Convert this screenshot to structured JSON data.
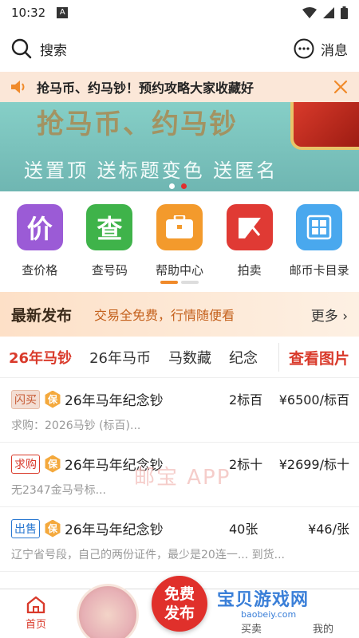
{
  "status_bar": {
    "time": "10:32",
    "sys_icon": "A"
  },
  "top_bar": {
    "search_label": "搜索",
    "messages_label": "消息"
  },
  "notice": {
    "text": "抢马币、约马钞！预约攻略大家收藏好"
  },
  "banner": {
    "line1": "抢马币、约马钞",
    "line2": "送置顶 送标题变色 送匿名"
  },
  "quick_links": [
    {
      "label": "查价格",
      "glyph": "价",
      "color": "#9b5bd6",
      "icon": "price-icon"
    },
    {
      "label": "查号码",
      "glyph": "查",
      "color": "#3fb34a",
      "icon": "lookup-icon"
    },
    {
      "label": "帮助中心",
      "glyph": "",
      "color": "#f39a2c",
      "icon": "briefcase-icon"
    },
    {
      "label": "拍卖",
      "glyph": "",
      "color": "#e03a34",
      "icon": "auction-icon"
    },
    {
      "label": "邮币卡目录",
      "glyph": "",
      "color": "#49a8ee",
      "icon": "catalog-icon"
    }
  ],
  "latest": {
    "title": "最新发布",
    "desc": "交易全免费，行情随便看",
    "more": "更多"
  },
  "tabs": {
    "items": [
      "26年马钞",
      "26年马币",
      "马数藏",
      "纪念"
    ],
    "active": 0,
    "view_images": "查看图片"
  },
  "listings": [
    {
      "badge": "闪买",
      "badge_type": "flash",
      "bao": "保",
      "name": "26年马年纪念钞",
      "qty": "2标百",
      "price": "¥6500/标百",
      "sub": "求购：2026马钞 (标百)..."
    },
    {
      "badge": "求购",
      "badge_type": "buy",
      "bao": "保",
      "name": "26年马年纪念钞",
      "qty": "2标十",
      "price": "¥2699/标十",
      "sub": "无2347金马号标..."
    },
    {
      "badge": "出售",
      "badge_type": "sell",
      "bao": "保",
      "name": "26年马年纪念钞",
      "qty": "40张",
      "price": "¥46/张",
      "sub": "辽宁省号段，自己的两份证件，最少是20连一... 到货..."
    }
  ],
  "watermark": "邮宝 APP",
  "bottom_nav": {
    "home": "首页",
    "publish_line1": "免费",
    "publish_line2": "发布",
    "buyer": "买卖",
    "mine": "我的"
  },
  "logo_watermark": {
    "big": "宝贝游戏网",
    "small": "baobeiy.com"
  },
  "colors": {
    "accent": "#d93a2b",
    "orange": "#f08a2a"
  }
}
